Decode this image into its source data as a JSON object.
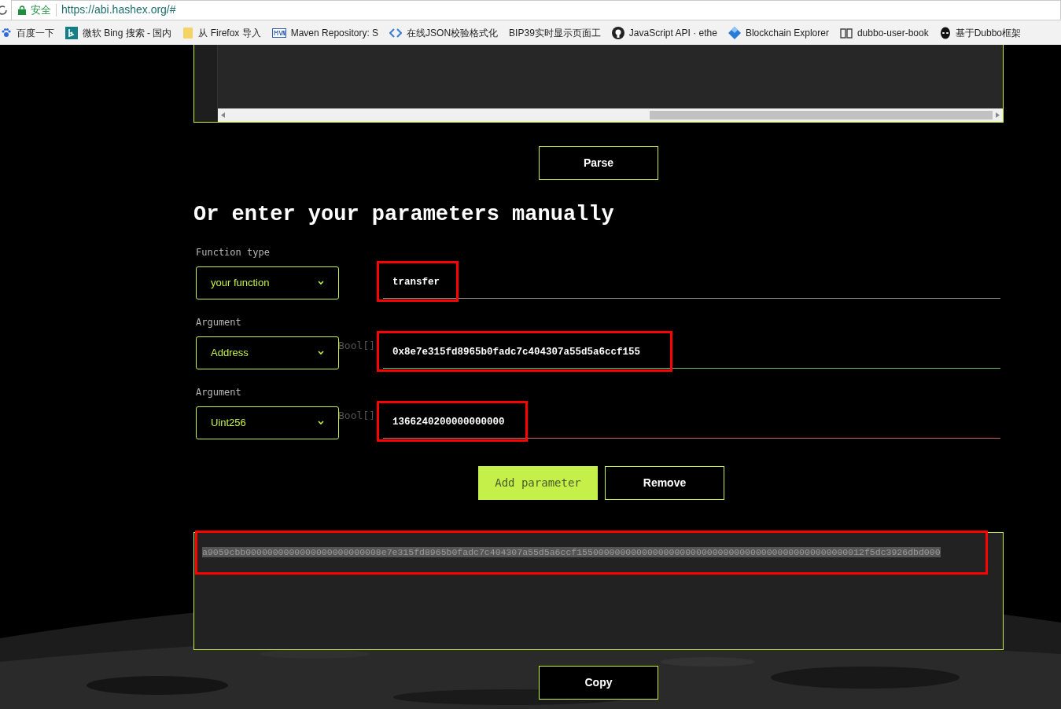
{
  "browser": {
    "security_label": "安全",
    "url": "https://abi.hashex.org/#",
    "bookmarks": [
      {
        "label": "百度一下"
      },
      {
        "label": "微软 Bing 搜索 - 国内"
      },
      {
        "label": "从 Firefox 导入"
      },
      {
        "label": "Maven Repository: S"
      },
      {
        "label": "在线JSON校验格式化"
      },
      {
        "label": "BIP39实时显示页面工"
      },
      {
        "label": "JavaScript API · ethe"
      },
      {
        "label": "Blockchain Explorer"
      },
      {
        "label": "dubbo-user-book"
      },
      {
        "label": "基于Dubbo框架"
      }
    ]
  },
  "parse_button": "Parse",
  "heading": "Or enter your parameters manually",
  "function_type": {
    "label": "Function type",
    "select": "your function",
    "name": "transfer",
    "highlighted": true,
    "focused": false,
    "invalid": false
  },
  "arguments": [
    {
      "label": "Argument",
      "select": "Address",
      "ghost": "Bool[]",
      "value": "0x8e7e315fd8965b0fadc7c404307a55d5a6ccf155",
      "highlighted": true,
      "focused": true,
      "invalid": false
    },
    {
      "label": "Argument",
      "select": "Uint256",
      "ghost": "Bool[]",
      "value": "1366240200000000000",
      "highlighted": true,
      "focused": false,
      "invalid": true
    }
  ],
  "buttons": [
    {
      "label": "Add parameter",
      "kind": "filled"
    },
    {
      "label": "Remove",
      "kind": "outline"
    }
  ],
  "output": {
    "value": "a9059cbb0000000000000000000000008e7e315fd8965b0fadc7c404307a55d5a6ccf15500000000000000000000000000000000000000000000000012f5dc3926dbd000",
    "highlighted": true,
    "selected": true
  },
  "copy_button": "Copy"
}
